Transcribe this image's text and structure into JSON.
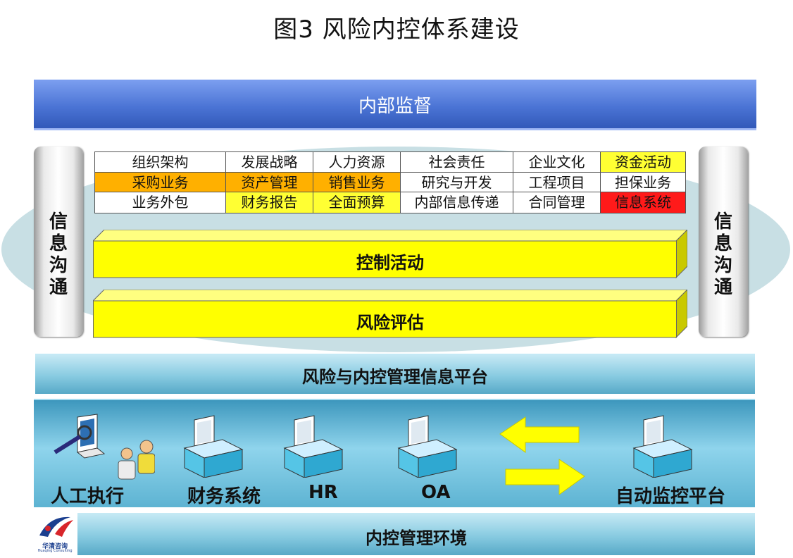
{
  "title": "图3  风险内控体系建设",
  "top_bar": "内部监督",
  "side_label": "信\n息\n沟\n通",
  "matrix": [
    {
      "text": "组织架构",
      "color": "#ffffff"
    },
    {
      "text": "发展战略",
      "color": "#ffffff"
    },
    {
      "text": "人力资源",
      "color": "#ffffff"
    },
    {
      "text": "社会责任",
      "color": "#ffffff"
    },
    {
      "text": "企业文化",
      "color": "#ffffff"
    },
    {
      "text": "资金活动",
      "color": "#ffff33"
    },
    {
      "text": "采购业务",
      "color": "#ffb000"
    },
    {
      "text": "资产管理",
      "color": "#ffb000"
    },
    {
      "text": "销售业务",
      "color": "#ffb000"
    },
    {
      "text": "研究与开发",
      "color": "#ffffff"
    },
    {
      "text": "工程项目",
      "color": "#ffffff"
    },
    {
      "text": "担保业务",
      "color": "#ffffff"
    },
    {
      "text": "业务外包",
      "color": "#ffffff"
    },
    {
      "text": "财务报告",
      "color": "#ffff33"
    },
    {
      "text": "全面预算",
      "color": "#ffff33"
    },
    {
      "text": "内部信息传递",
      "color": "#ffffff"
    },
    {
      "text": "合同管理",
      "color": "#ffffff"
    },
    {
      "text": "信息系统",
      "color": "#ff1a1a"
    }
  ],
  "layers": {
    "control": "控制活动",
    "risk": "风险评估",
    "platform": "风险与内控管理信息平台",
    "environment": "内控管理环境"
  },
  "systems": [
    "人工执行",
    "财务系统",
    "HR",
    "OA",
    "自动监控平台"
  ],
  "logo": {
    "cn": "华清咨询",
    "en": "Huaqing Consulting"
  },
  "colors": {
    "prism": "#ffff00",
    "blue_bar": "#4a73d4",
    "teal": "#88cbe1"
  }
}
